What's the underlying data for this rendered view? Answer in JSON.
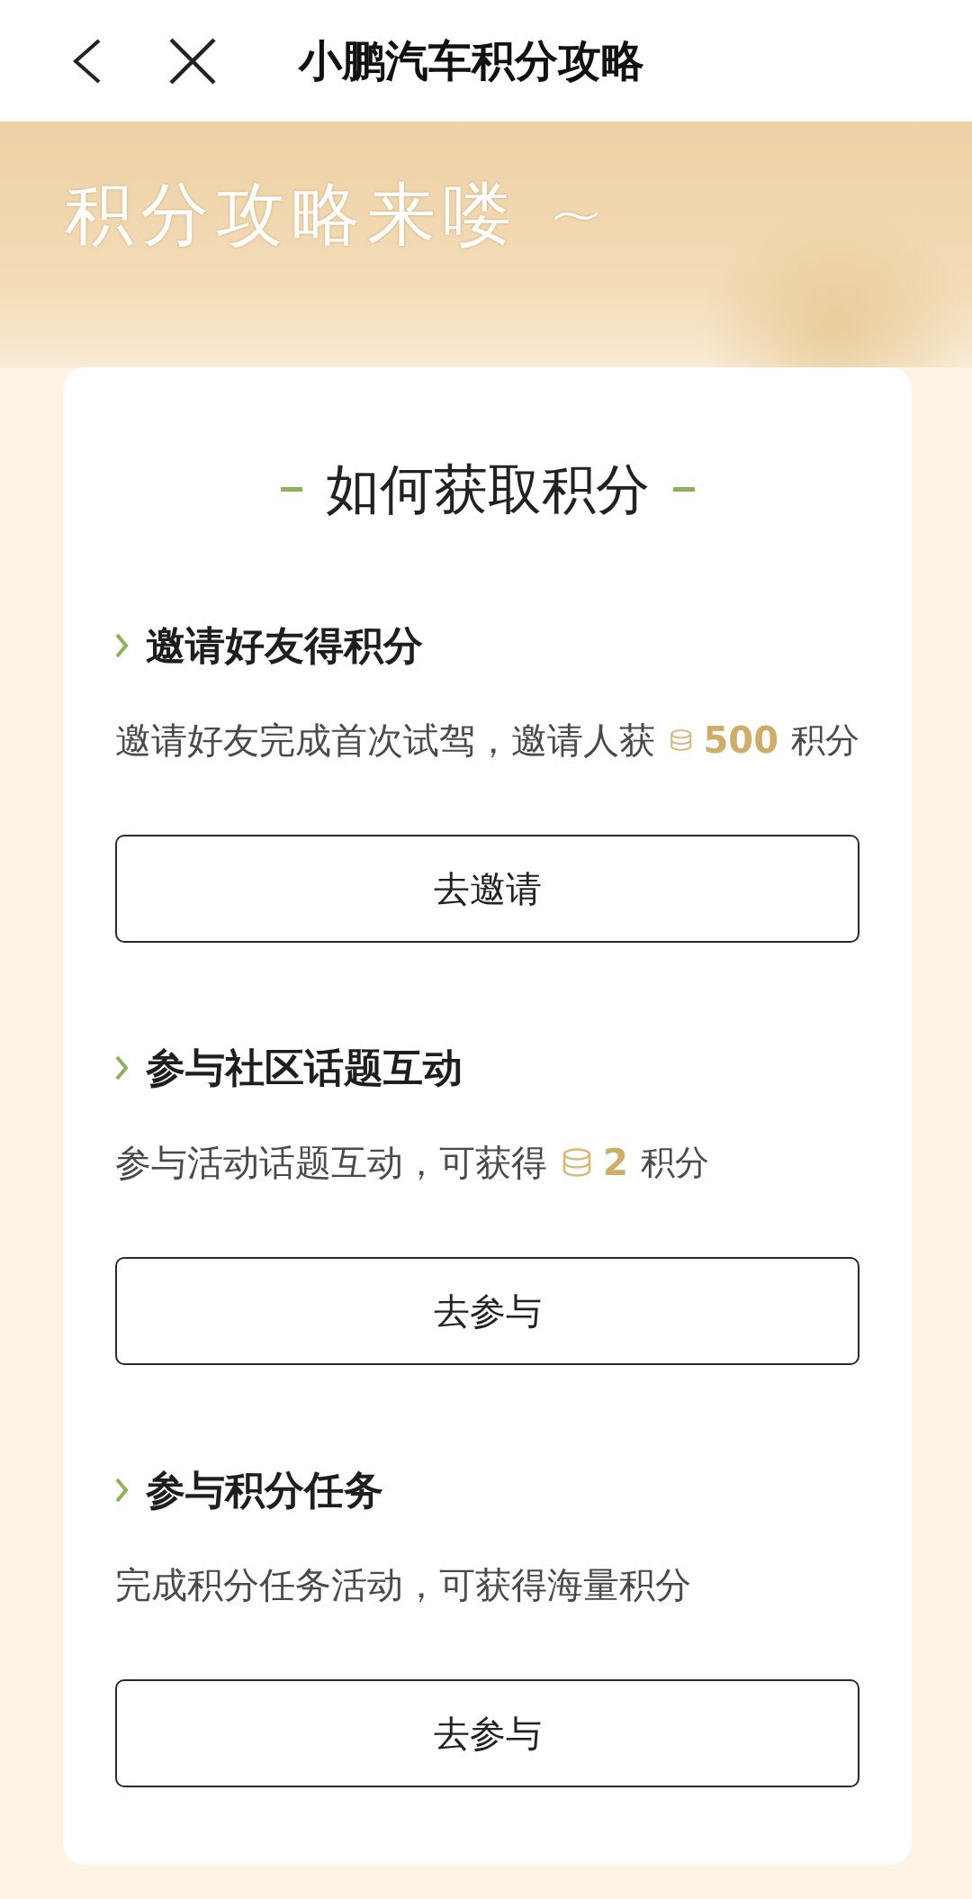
{
  "header": {
    "title": "小鹏汽车积分攻略"
  },
  "banner": {
    "headline": "积分攻略来喽 ~"
  },
  "card": {
    "title": "如何获取积分",
    "sections": [
      {
        "heading": "邀请好友得积分",
        "description": "邀请好友完成首次试驾，邀请人获",
        "reward": {
          "amount": "500",
          "unit": "积分"
        },
        "button": "去邀请"
      },
      {
        "heading": "参与社区话题互动",
        "description": "参与活动话题互动，可获得",
        "reward": {
          "amount": "2",
          "unit": "积分"
        },
        "button": "去参与"
      },
      {
        "heading": "参与积分任务",
        "description": "完成积分任务活动，可获得海量积分",
        "button": "去参与"
      }
    ]
  }
}
